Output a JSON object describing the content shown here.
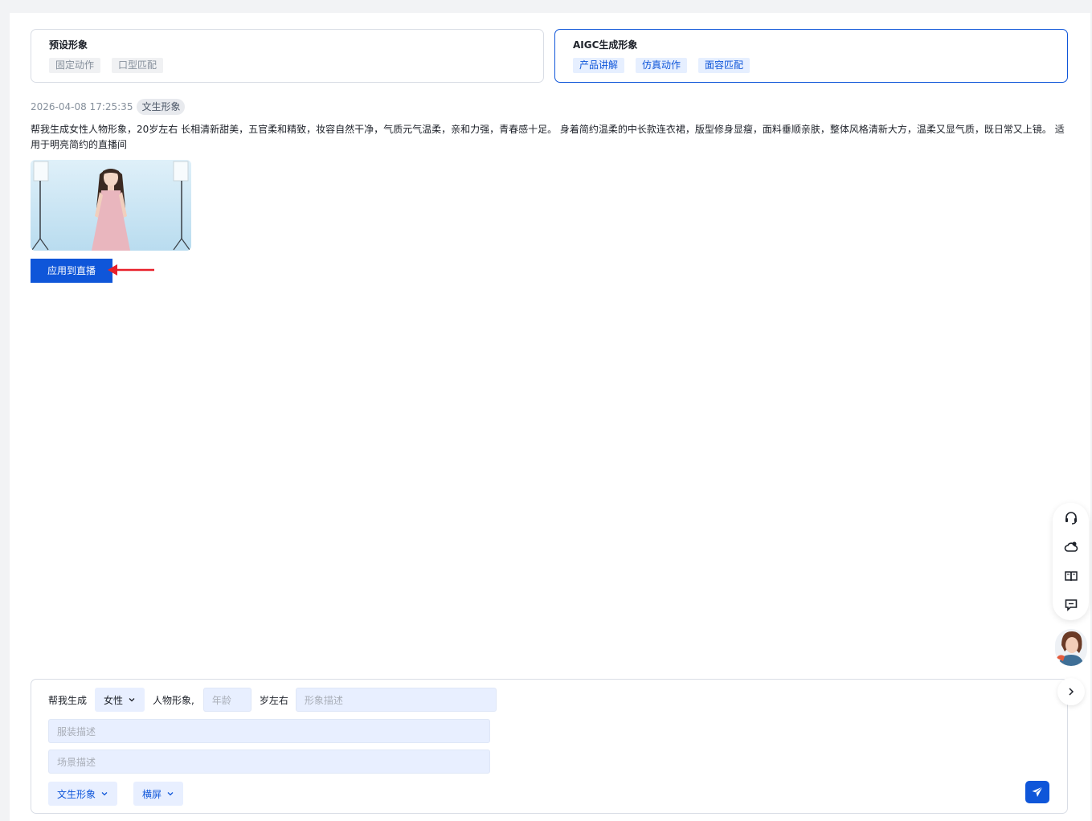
{
  "avatar_types": [
    {
      "title": "预设形象",
      "tags": [
        "固定动作",
        "口型匹配"
      ],
      "selected": false
    },
    {
      "title": "AIGC生成形象",
      "tags": [
        "产品讲解",
        "仿真动作",
        "面容匹配"
      ],
      "selected": true
    }
  ],
  "record": {
    "timestamp": "2026-04-08 17:25:35",
    "badge": "文生形象",
    "prompt_line1": "帮我生成女性人物形象，20岁左右 长相清新甜美，五官柔和精致，妆容自然干净，气质元气温柔，亲和力强，青春感十足。 身着简约温柔的中长款连衣裙，版型修身显瘦，面料垂顺亲肤，整体风格清新大方，温柔又显气质，既日常又上镜。 适",
    "prompt_line2": "用于明亮简约的直播间",
    "apply_label": "应用到直播"
  },
  "composer": {
    "prefix": "帮我生成",
    "gender": "女性",
    "mid": "人物形象,",
    "age_placeholder": "年龄",
    "age_suffix": "岁左右",
    "appearance_placeholder": "形象描述",
    "outfit_placeholder": "服装描述",
    "scene_placeholder": "场景描述",
    "mode": "文生形象",
    "orientation": "横屏"
  },
  "side_toolbar": {
    "icons": [
      "headset-icon",
      "cloud-upload-icon",
      "book-icon",
      "feedback-icon"
    ]
  },
  "colors": {
    "primary": "#0f56d9",
    "field_bg": "#e8efff",
    "annotation_arrow": "#e8202a"
  }
}
